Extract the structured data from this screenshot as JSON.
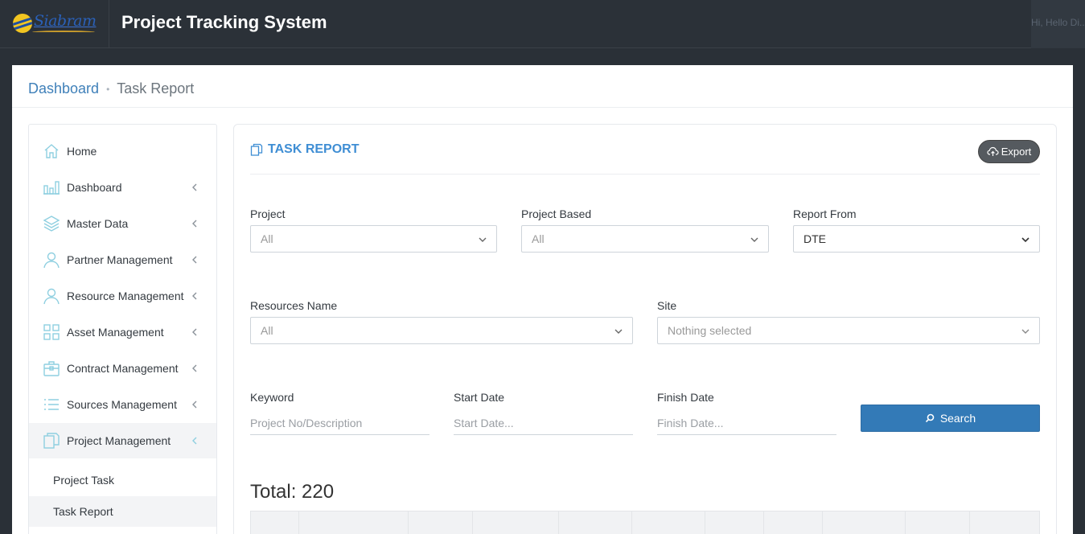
{
  "header": {
    "logo_text": "Siabram",
    "app_title": "Project Tracking System",
    "user_text": "Hi, Hello Di..."
  },
  "breadcrumb": {
    "link": "Dashboard",
    "separator": "•",
    "current": "Task Report"
  },
  "sidebar": {
    "items": [
      {
        "label": "Home",
        "icon": "home-icon",
        "has_chevron": false
      },
      {
        "label": "Dashboard",
        "icon": "bar-chart-icon",
        "has_chevron": true
      },
      {
        "label": "Master Data",
        "icon": "layers-icon",
        "has_chevron": true
      },
      {
        "label": "Partner Management",
        "icon": "user-icon",
        "has_chevron": true
      },
      {
        "label": "Resource Management",
        "icon": "user-icon",
        "has_chevron": true
      },
      {
        "label": "Asset Management",
        "icon": "grid-icon",
        "has_chevron": true
      },
      {
        "label": "Contract Management",
        "icon": "briefcase-icon",
        "has_chevron": true
      },
      {
        "label": "Sources Management",
        "icon": "list-icon",
        "has_chevron": true
      },
      {
        "label": "Project Management",
        "icon": "copy-icon",
        "has_chevron": true,
        "active": true
      }
    ],
    "sub_items": [
      {
        "label": "Project Task"
      },
      {
        "label": "Task Report",
        "active": true
      }
    ]
  },
  "report": {
    "title": "TASK REPORT",
    "export_label": "Export",
    "fields": {
      "project": {
        "label": "Project",
        "value": "All"
      },
      "project_based": {
        "label": "Project Based",
        "value": "All"
      },
      "report_from": {
        "label": "Report From",
        "value": "DTE"
      },
      "resources_name": {
        "label": "Resources Name",
        "value": "All"
      },
      "site": {
        "label": "Site",
        "value": "Nothing selected"
      },
      "keyword": {
        "label": "Keyword",
        "placeholder": "Project No/Description"
      },
      "start_date": {
        "label": "Start Date",
        "placeholder": "Start Date..."
      },
      "finish_date": {
        "label": "Finish Date",
        "placeholder": "Finish Date..."
      }
    },
    "search_label": "Search",
    "total_text": "Total: 220"
  },
  "colors": {
    "accent": "#3f8ed4",
    "primary_button": "#337ab7",
    "topbar": "#2b3138",
    "export_button": "#555a5f"
  }
}
